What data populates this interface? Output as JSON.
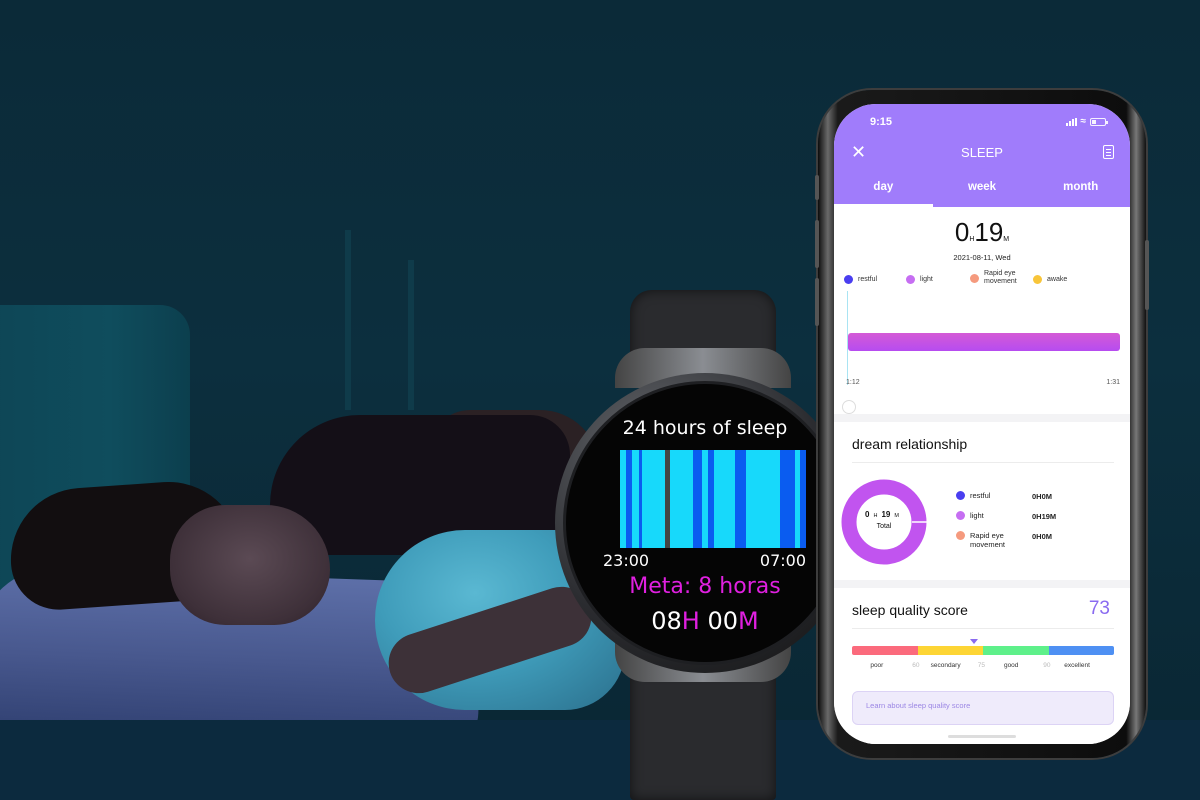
{
  "watch": {
    "title": "24 hours of sleep",
    "start_time": "23:00",
    "end_time": "07:00",
    "goal": "Meta: 8 horas",
    "hours": "08",
    "hours_unit": "H",
    "minutes": "00",
    "minutes_unit": "M",
    "colors": {
      "light": "#17d9fb",
      "deep": "#0a5cf0",
      "awake": "#444444"
    },
    "segments": [
      {
        "start": 0.03,
        "end": 0.065,
        "type": "deep"
      },
      {
        "start": 0.1,
        "end": 0.12,
        "type": "deep"
      },
      {
        "start": 0.24,
        "end": 0.27,
        "type": "awake"
      },
      {
        "start": 0.39,
        "end": 0.44,
        "type": "deep"
      },
      {
        "start": 0.475,
        "end": 0.505,
        "type": "deep"
      },
      {
        "start": 0.62,
        "end": 0.68,
        "type": "deep"
      },
      {
        "start": 0.86,
        "end": 0.94,
        "type": "deep"
      },
      {
        "start": 0.97,
        "end": 1.0,
        "type": "deep"
      }
    ]
  },
  "phone": {
    "status_time": "9:15",
    "header": {
      "title": "SLEEP",
      "close_icon": "close-icon",
      "report_icon": "document-icon",
      "tabs": [
        {
          "label": "day",
          "active": true
        },
        {
          "label": "week",
          "active": false
        },
        {
          "label": "month",
          "active": false
        }
      ]
    },
    "summary": {
      "hours": "0",
      "hours_unit": "H",
      "minutes": "19",
      "minutes_unit": "M",
      "date": "2021-08-11, Wed",
      "legend": [
        {
          "label": "restful",
          "color": "#4a3ef0"
        },
        {
          "label": "light",
          "color": "#c66ef2"
        },
        {
          "label": "Rapid eye movement",
          "color": "#f59a7e"
        },
        {
          "label": "awake",
          "color": "#f8c53a"
        }
      ],
      "axis_start": "1:12",
      "axis_end": "1:31"
    },
    "dream": {
      "title": "dream relationship",
      "total_hours": "0",
      "total_hours_unit": "H",
      "total_minutes": "19",
      "total_minutes_unit": "M",
      "total_label": "Total",
      "light_fraction": 1.0,
      "rows": [
        {
          "label": "restful",
          "value": "0H0M",
          "color": "#4a3ef0"
        },
        {
          "label": "light",
          "value": "0H19M",
          "color": "#c66ef2"
        },
        {
          "label": "Rapid eye movement",
          "value": "0H0M",
          "color": "#f59a7e"
        }
      ]
    },
    "quality": {
      "title": "sleep quality score",
      "score": "73",
      "bands": [
        {
          "label": "poor",
          "color": "#fb6a7c"
        },
        {
          "label": "secondary",
          "color": "#fdd535"
        },
        {
          "label": "good",
          "color": "#5ef08a"
        },
        {
          "label": "excellent",
          "color": "#4e90f3"
        }
      ],
      "thresholds": [
        "60",
        "75",
        "90"
      ],
      "learn_link": "Learn about sleep quality score"
    }
  }
}
